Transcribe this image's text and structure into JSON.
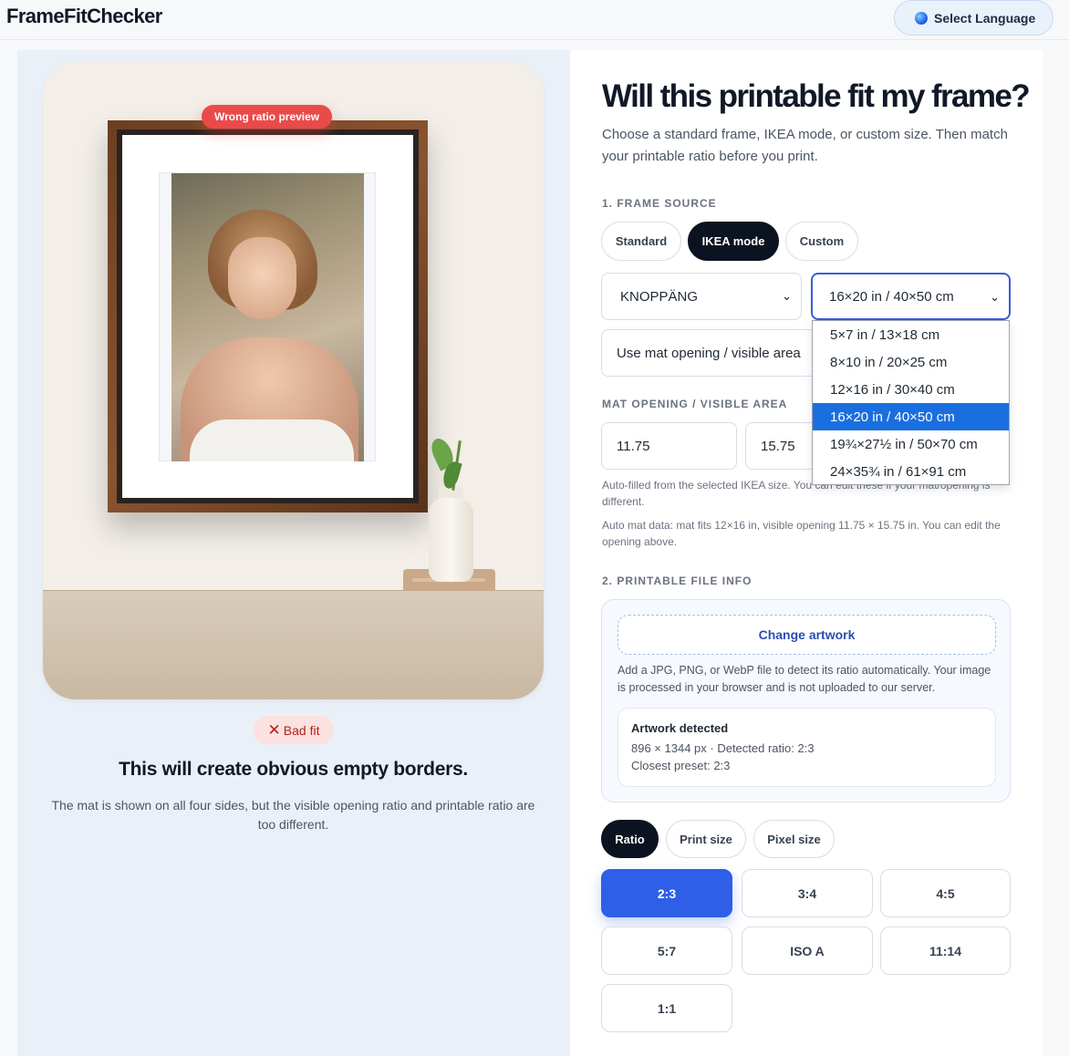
{
  "header": {
    "brand": "FrameFitChecker",
    "language_button": "Select Language"
  },
  "preview": {
    "badge": "Wrong ratio preview",
    "fit_badge": "Bad fit",
    "result_title": "This will create obvious empty borders.",
    "result_description": "The mat is shown on all four sides, but the visible opening ratio and printable ratio are too different."
  },
  "form": {
    "title": "Will this printable fit my frame?",
    "subtitle": "Choose a standard frame, IKEA mode, or custom size. Then match your printable ratio before you print.",
    "frame_source_label": "1. FRAME SOURCE",
    "source_tabs": [
      {
        "label": "Standard",
        "active": false
      },
      {
        "label": "IKEA mode",
        "active": true
      },
      {
        "label": "Custom",
        "active": false
      }
    ],
    "frame_model": "KNOPPÄNG",
    "frame_size": "16×20 in / 40×50 cm",
    "mat_mode": "Use mat opening / visible area",
    "mat_opening_label": "MAT OPENING / VISIBLE AREA",
    "opening_width": "11.75",
    "opening_height": "15.75",
    "hint_autofill": "Auto-filled from the selected IKEA size. You can edit these if your mat/opening is different.",
    "hint_matdata": "Auto mat data: mat fits 12×16 in, visible opening 11.75 × 15.75 in. You can edit the opening above.",
    "size_options": [
      {
        "label": "5×7 in / 13×18 cm",
        "selected": false
      },
      {
        "label": "8×10 in / 20×25 cm",
        "selected": false
      },
      {
        "label": "12×16 in / 30×40 cm",
        "selected": false
      },
      {
        "label": "16×20 in / 40×50 cm",
        "selected": true
      },
      {
        "label": "19¾×27½ in / 50×70 cm",
        "selected": false
      },
      {
        "label": "24×35¾ in / 61×91 cm",
        "selected": false
      }
    ]
  },
  "file": {
    "section_label": "2. PRINTABLE FILE INFO",
    "change_button": "Change artwork",
    "description": "Add a JPG, PNG, or WebP file to detect its ratio automatically. Your image is processed in your browser and is not uploaded to our server.",
    "card_title": "Artwork detected",
    "card_line1": "896 × 1344 px · Detected ratio: 2:3",
    "card_line2": "Closest preset: 2:3"
  },
  "ratio": {
    "mode_tabs": [
      {
        "label": "Ratio",
        "active": true
      },
      {
        "label": "Print size",
        "active": false
      },
      {
        "label": "Pixel size",
        "active": false
      }
    ],
    "presets": [
      {
        "label": "2:3",
        "active": true
      },
      {
        "label": "3:4",
        "active": false
      },
      {
        "label": "4:5",
        "active": false
      },
      {
        "label": "5:7",
        "active": false
      },
      {
        "label": "ISO A",
        "active": false
      },
      {
        "label": "11:14",
        "active": false
      },
      {
        "label": "1:1",
        "active": false
      }
    ]
  },
  "colors": {
    "accent": "#2e5fe6",
    "dark": "#0b1220",
    "danger": "#ea4a4a",
    "dropdown_selected": "#1a6fe0"
  },
  "icons": {
    "language": "globe-icon",
    "bad_fit": "x-icon",
    "select": "chevron-down-icon"
  }
}
